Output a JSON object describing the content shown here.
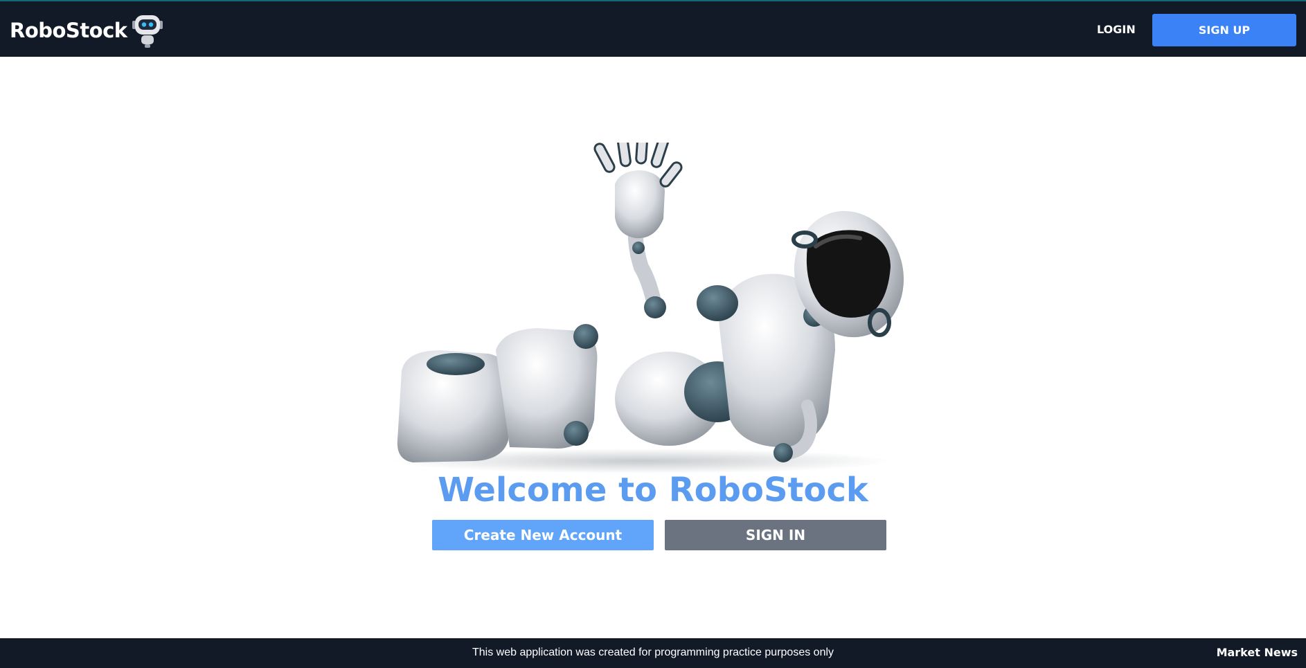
{
  "header": {
    "brand": "RoboStock",
    "login_label": "LOGIN",
    "signup_label": "SIGN UP"
  },
  "hero": {
    "title": "Welcome to RoboStock",
    "create_label": "Create New Account",
    "signin_label": "SIGN IN"
  },
  "footer": {
    "note": "This web application was created for programming practice purposes only",
    "news_label": "Market News"
  },
  "colors": {
    "navbar": "#121a28",
    "accent_blue": "#3b82f6",
    "title_blue": "#5b9cf0",
    "create_button": "#60a5fa",
    "signin_button": "#6b7280"
  },
  "icons": {
    "logo": "robot-mascot-icon",
    "hero": "waving-robot-illustration"
  }
}
